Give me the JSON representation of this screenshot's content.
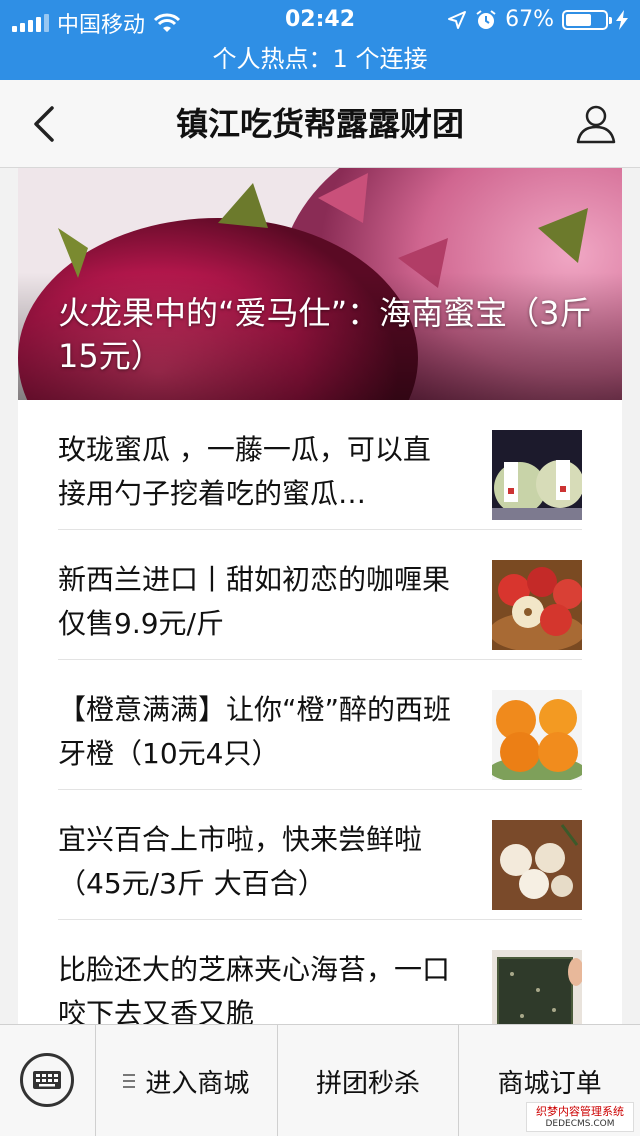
{
  "statusbar": {
    "carrier": "中国移动",
    "time": "02:42",
    "battery_pct": "67%",
    "battery_level": 0.67
  },
  "hotspot": {
    "text": "个人热点：1 个连接"
  },
  "navbar": {
    "title": "镇江吃货帮露露财团"
  },
  "hero": {
    "title": "火龙果中的“爱马仕”：海南蜜宝（3斤15元）"
  },
  "articles": [
    {
      "text": "玫珑蜜瓜 ，一藤一瓜，可以直接用勺子挖着吃的蜜瓜…",
      "thumb_icon": "melon-photo"
    },
    {
      "text": "新西兰进口丨甜如初恋的咖喱果仅售9.9元/斤",
      "thumb_icon": "apple-photo"
    },
    {
      "text": "【橙意满满】让你“橙”醉的西班牙橙（10元4只）",
      "thumb_icon": "orange-photo"
    },
    {
      "text": "宜兴百合上市啦，快来尝鲜啦（45元/3斤 大百合）",
      "thumb_icon": "lily-bulb-photo"
    },
    {
      "text": "比脸还大的芝麻夹心海苔，一口咬下去又香又脆",
      "thumb_icon": "seaweed-photo"
    }
  ],
  "bottombar": {
    "tab1": "进入商城",
    "tab2": "拼团秒杀",
    "tab3": "商城订单"
  },
  "watermark": {
    "line1": "织梦内容管理系统",
    "line2": "DEDECMS.COM"
  },
  "colors": {
    "statusbar": "#2f8fe5",
    "navbar": "#f7f7f7"
  }
}
